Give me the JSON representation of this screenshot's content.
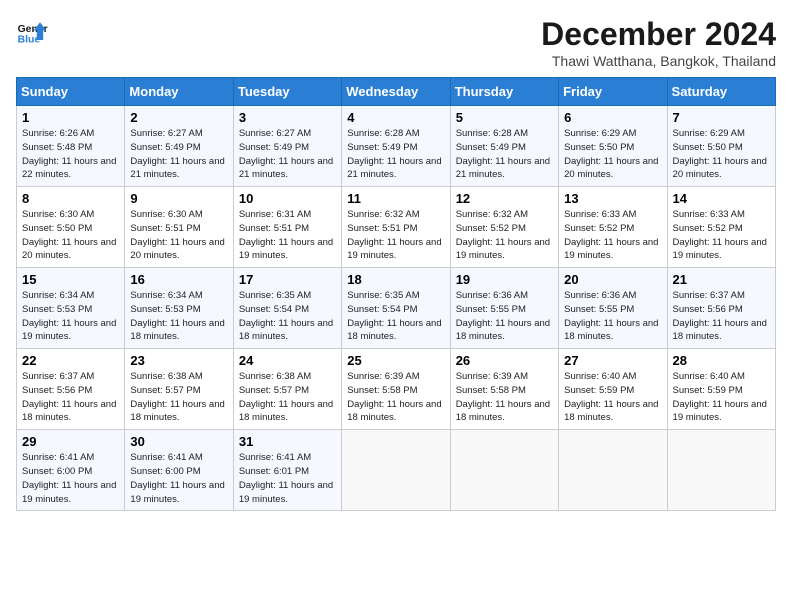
{
  "header": {
    "logo_line1": "General",
    "logo_line2": "Blue",
    "month": "December 2024",
    "location": "Thawi Watthana, Bangkok, Thailand"
  },
  "weekdays": [
    "Sunday",
    "Monday",
    "Tuesday",
    "Wednesday",
    "Thursday",
    "Friday",
    "Saturday"
  ],
  "weeks": [
    [
      {
        "day": "1",
        "sunrise": "6:26 AM",
        "sunset": "5:48 PM",
        "daylight": "11 hours and 22 minutes."
      },
      {
        "day": "2",
        "sunrise": "6:27 AM",
        "sunset": "5:49 PM",
        "daylight": "11 hours and 21 minutes."
      },
      {
        "day": "3",
        "sunrise": "6:27 AM",
        "sunset": "5:49 PM",
        "daylight": "11 hours and 21 minutes."
      },
      {
        "day": "4",
        "sunrise": "6:28 AM",
        "sunset": "5:49 PM",
        "daylight": "11 hours and 21 minutes."
      },
      {
        "day": "5",
        "sunrise": "6:28 AM",
        "sunset": "5:49 PM",
        "daylight": "11 hours and 21 minutes."
      },
      {
        "day": "6",
        "sunrise": "6:29 AM",
        "sunset": "5:50 PM",
        "daylight": "11 hours and 20 minutes."
      },
      {
        "day": "7",
        "sunrise": "6:29 AM",
        "sunset": "5:50 PM",
        "daylight": "11 hours and 20 minutes."
      }
    ],
    [
      {
        "day": "8",
        "sunrise": "6:30 AM",
        "sunset": "5:50 PM",
        "daylight": "11 hours and 20 minutes."
      },
      {
        "day": "9",
        "sunrise": "6:30 AM",
        "sunset": "5:51 PM",
        "daylight": "11 hours and 20 minutes."
      },
      {
        "day": "10",
        "sunrise": "6:31 AM",
        "sunset": "5:51 PM",
        "daylight": "11 hours and 19 minutes."
      },
      {
        "day": "11",
        "sunrise": "6:32 AM",
        "sunset": "5:51 PM",
        "daylight": "11 hours and 19 minutes."
      },
      {
        "day": "12",
        "sunrise": "6:32 AM",
        "sunset": "5:52 PM",
        "daylight": "11 hours and 19 minutes."
      },
      {
        "day": "13",
        "sunrise": "6:33 AM",
        "sunset": "5:52 PM",
        "daylight": "11 hours and 19 minutes."
      },
      {
        "day": "14",
        "sunrise": "6:33 AM",
        "sunset": "5:52 PM",
        "daylight": "11 hours and 19 minutes."
      }
    ],
    [
      {
        "day": "15",
        "sunrise": "6:34 AM",
        "sunset": "5:53 PM",
        "daylight": "11 hours and 19 minutes."
      },
      {
        "day": "16",
        "sunrise": "6:34 AM",
        "sunset": "5:53 PM",
        "daylight": "11 hours and 18 minutes."
      },
      {
        "day": "17",
        "sunrise": "6:35 AM",
        "sunset": "5:54 PM",
        "daylight": "11 hours and 18 minutes."
      },
      {
        "day": "18",
        "sunrise": "6:35 AM",
        "sunset": "5:54 PM",
        "daylight": "11 hours and 18 minutes."
      },
      {
        "day": "19",
        "sunrise": "6:36 AM",
        "sunset": "5:55 PM",
        "daylight": "11 hours and 18 minutes."
      },
      {
        "day": "20",
        "sunrise": "6:36 AM",
        "sunset": "5:55 PM",
        "daylight": "11 hours and 18 minutes."
      },
      {
        "day": "21",
        "sunrise": "6:37 AM",
        "sunset": "5:56 PM",
        "daylight": "11 hours and 18 minutes."
      }
    ],
    [
      {
        "day": "22",
        "sunrise": "6:37 AM",
        "sunset": "5:56 PM",
        "daylight": "11 hours and 18 minutes."
      },
      {
        "day": "23",
        "sunrise": "6:38 AM",
        "sunset": "5:57 PM",
        "daylight": "11 hours and 18 minutes."
      },
      {
        "day": "24",
        "sunrise": "6:38 AM",
        "sunset": "5:57 PM",
        "daylight": "11 hours and 18 minutes."
      },
      {
        "day": "25",
        "sunrise": "6:39 AM",
        "sunset": "5:58 PM",
        "daylight": "11 hours and 18 minutes."
      },
      {
        "day": "26",
        "sunrise": "6:39 AM",
        "sunset": "5:58 PM",
        "daylight": "11 hours and 18 minutes."
      },
      {
        "day": "27",
        "sunrise": "6:40 AM",
        "sunset": "5:59 PM",
        "daylight": "11 hours and 18 minutes."
      },
      {
        "day": "28",
        "sunrise": "6:40 AM",
        "sunset": "5:59 PM",
        "daylight": "11 hours and 19 minutes."
      }
    ],
    [
      {
        "day": "29",
        "sunrise": "6:41 AM",
        "sunset": "6:00 PM",
        "daylight": "11 hours and 19 minutes."
      },
      {
        "day": "30",
        "sunrise": "6:41 AM",
        "sunset": "6:00 PM",
        "daylight": "11 hours and 19 minutes."
      },
      {
        "day": "31",
        "sunrise": "6:41 AM",
        "sunset": "6:01 PM",
        "daylight": "11 hours and 19 minutes."
      },
      null,
      null,
      null,
      null
    ]
  ],
  "labels": {
    "sunrise": "Sunrise:",
    "sunset": "Sunset:",
    "daylight": "Daylight:"
  }
}
